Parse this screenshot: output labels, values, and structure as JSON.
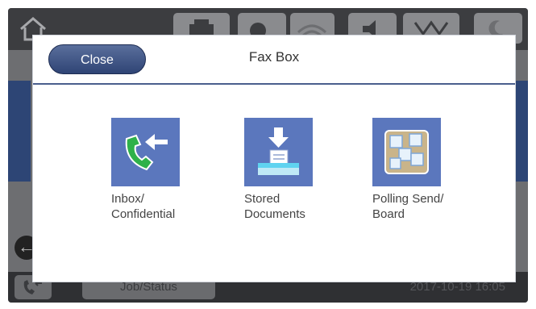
{
  "background": {
    "job_status_label": "Job/Status",
    "datetime": "2017-10-19 16:05"
  },
  "dialog": {
    "title": "Fax Box",
    "close_label": "Close",
    "items": [
      {
        "label_line1": "Inbox/",
        "label_line2": "Confidential",
        "icon": "inbox-phone-icon"
      },
      {
        "label_line1": "Stored",
        "label_line2": "Documents",
        "icon": "stored-documents-icon"
      },
      {
        "label_line1": "Polling Send/",
        "label_line2": "Board",
        "icon": "polling-board-icon"
      }
    ]
  },
  "colors": {
    "dialog_header_rule": "#4a5f8d",
    "close_button": "#2f4475",
    "tile_background": "#5b77bd",
    "phone_green": "#2fb14a"
  }
}
